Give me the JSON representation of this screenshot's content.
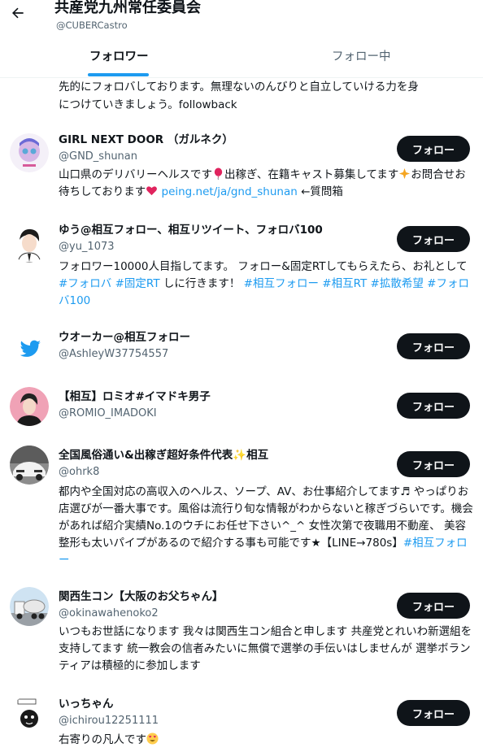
{
  "header": {
    "title": "共産党九州常任委員会",
    "handle": "@CUBERCastro",
    "tabs": [
      "フォロワー",
      "フォロー中"
    ]
  },
  "prev_bio": {
    "line1": "先的にフォロバしております。無理ないのんびりと自立していける力を身",
    "line2": "につけていきましょう。followback"
  },
  "follow_label": "フォロー",
  "users": [
    {
      "name": "GIRL NEXT DOOR （ガルネク）",
      "handle": "@GND_shunan",
      "bio": [
        {
          "t": "山口県のデリバリーヘルスです"
        },
        {
          "icon": "balloon-emoji"
        },
        {
          "t": "出稼ぎ、在籍キャスト募集してます"
        },
        {
          "icon": "sparkle-star-emoji"
        },
        {
          "t": "お問合せお待ちしております"
        },
        {
          "icon": "heart-emoji"
        },
        {
          "t": " "
        },
        {
          "t": "peing.net/ja/gnd_shunan",
          "link": true
        },
        {
          "t": " ←質問箱"
        }
      ]
    },
    {
      "name": "ゆう@相互フォロー、相互リツイート、フォロバ100",
      "handle": "@yu_1073",
      "bio": [
        {
          "t": "フォロワー10000人目指してます。 フォロー&固定RTしてもらえたら、お礼として "
        },
        {
          "t": "#フォロバ",
          "link": true
        },
        {
          "t": " "
        },
        {
          "t": "#固定RT",
          "link": true
        },
        {
          "t": " しに行きます！ "
        },
        {
          "t": "#相互フォロー",
          "link": true
        },
        {
          "t": " "
        },
        {
          "t": "#相互RT",
          "link": true
        },
        {
          "t": " "
        },
        {
          "t": "#拡散希望",
          "link": true
        },
        {
          "t": " "
        },
        {
          "t": "#フォロバ100",
          "link": true
        }
      ]
    },
    {
      "name": "ウオーカー@相互フォロー",
      "handle": "@AshleyW37754557",
      "bio": []
    },
    {
      "name": "【相互】ロミオ#イマドキ男子",
      "handle": "@ROMIO_IMADOKI",
      "bio": []
    },
    {
      "name": "全国風俗通い&出稼ぎ超好条件代表✨相互",
      "handle": "@ohrk8",
      "bio": [
        {
          "t": "都内や全国対応の高収入のヘルス、ソープ、AV、お仕事紹介してます♬ やっぱりお店選びが一番大事です。風俗は流行り旬な情報がわからないと稼ぎづらいです。機会があれば紹介実績No.1のウチにお任せ下さい^_^ 女性次第で夜職用不動産、 美容整形も太いパイプがあるので紹介する事も可能です★【LINE→780s】"
        },
        {
          "t": "#相互フォロー",
          "link": true
        }
      ]
    },
    {
      "name": "関西生コン【大阪のお父ちゃん】",
      "handle": "@okinawahenoko2",
      "bio": [
        {
          "t": "いつもお世話になります 我々は関西生コン組合と申します 共産党とれいわ新選組を支持してます 統一教会の信者みたいに無償で選挙の手伝いはしませんが 選挙ボランティアは積極的に参加します"
        }
      ]
    },
    {
      "name": "いっちゃん",
      "handle": "@ichirou12251111",
      "bio": [
        {
          "t": "右寄りの凡人です"
        },
        {
          "icon": "heart-eyes-emoji"
        }
      ]
    }
  ],
  "colors": {
    "accent": "#1d9bf0",
    "text": "#0f1419",
    "muted": "#536471",
    "button": "#0f1419"
  }
}
